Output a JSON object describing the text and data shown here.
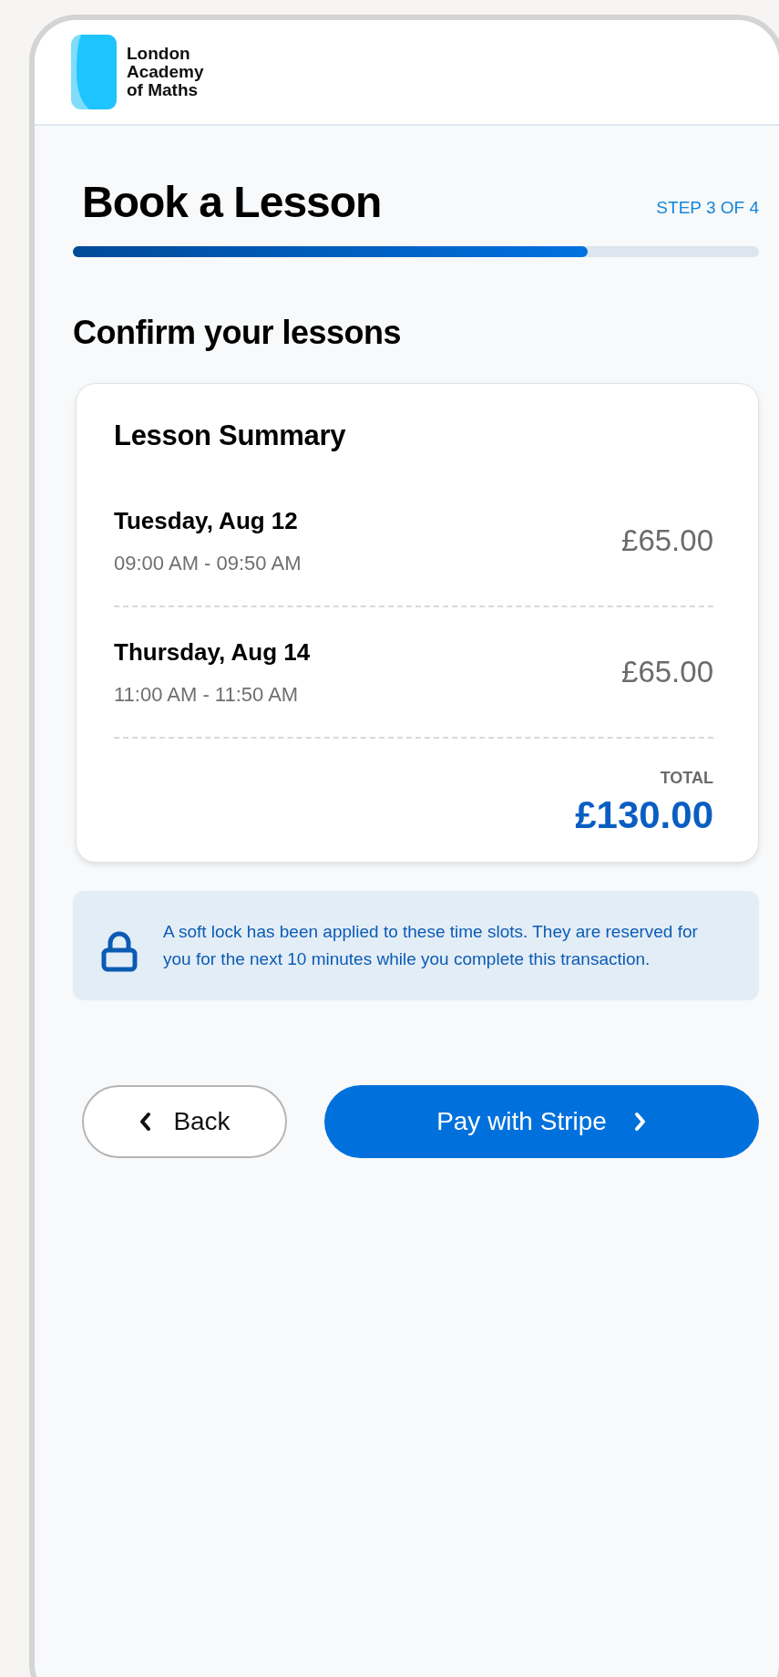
{
  "header": {
    "logo_lines": [
      "London",
      "Academy",
      "of Maths"
    ]
  },
  "page": {
    "title": "Book a Lesson",
    "step": "STEP 3 OF 4",
    "progress": {
      "level": 0.75
    },
    "subtitle": "Confirm your lessons"
  },
  "summary": {
    "title": "Lesson Summary",
    "lessons": [
      {
        "date": "Tuesday, Aug 12",
        "time": "09:00 AM - 09:50 AM",
        "price": "£65.00"
      },
      {
        "date": "Thursday, Aug 14",
        "time": "11:00 AM - 11:50 AM",
        "price": "£65.00"
      }
    ],
    "total_label": "TOTAL",
    "total": "£130.00"
  },
  "notice": {
    "text": "A soft lock has been applied to these time slots. They are reserved for you for the next 10 minutes while you complete this transaction."
  },
  "buttons": [
    {
      "label": "Back",
      "kind": "secondary"
    },
    {
      "label": "Pay with Stripe",
      "kind": "primary"
    }
  ]
}
